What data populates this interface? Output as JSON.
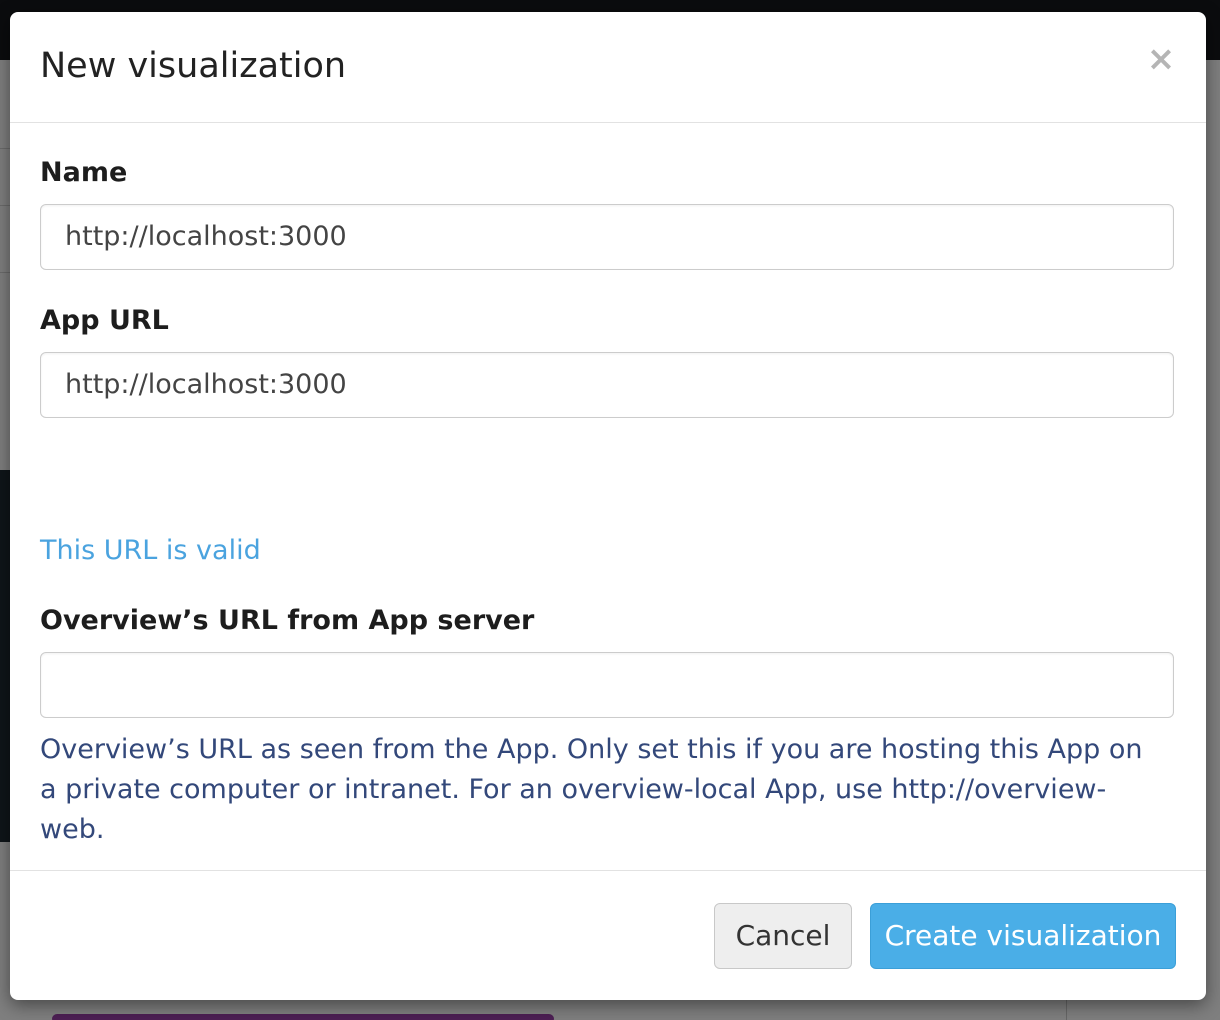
{
  "modal": {
    "title": "New visualization",
    "close_label": "×"
  },
  "form": {
    "name": {
      "label": "Name",
      "value": "http://localhost:3000"
    },
    "app_url": {
      "label": "App URL",
      "value": "http://localhost:3000",
      "validation": "This URL is valid"
    },
    "server_url": {
      "label": "Overview’s URL from App server",
      "value": "",
      "help": "Overview’s URL as seen from the App. Only set this if you are hosting this App on a private computer or intranet. For an overview-local App, use http://overview-web."
    }
  },
  "footer": {
    "cancel_label": "Cancel",
    "create_label": "Create visualization"
  },
  "colors": {
    "accent": "#4aaee7",
    "valid_text": "#4aa3df",
    "help_text": "#33487a"
  }
}
